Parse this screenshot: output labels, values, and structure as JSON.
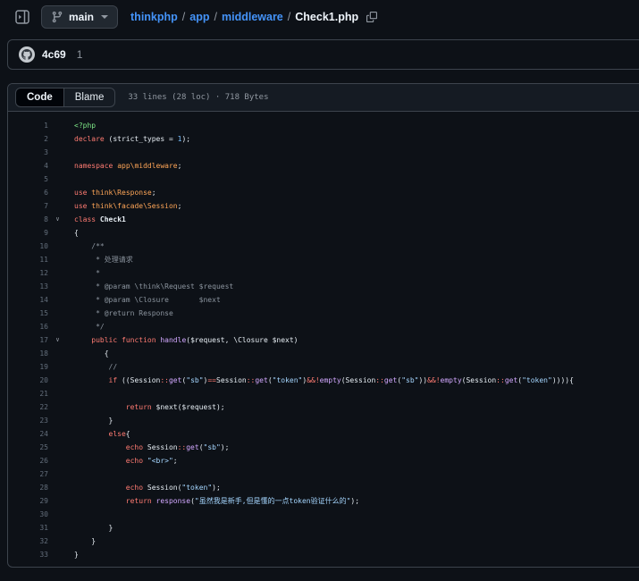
{
  "topbar": {
    "branch": "main",
    "breadcrumb": [
      "thinkphp",
      "app",
      "middleware"
    ],
    "separator": "/",
    "filename": "Check1.php",
    "icons": [
      "sidebar-expand-icon",
      "git-branch-icon",
      "caret-down-icon",
      "copy-path-icon"
    ]
  },
  "commit": {
    "title": "4c69",
    "meta": "1",
    "avatar_icon": "github-octocat-avatar"
  },
  "file_header": {
    "tabs": [
      {
        "label": "Code",
        "active": true
      },
      {
        "label": "Blame",
        "active": false
      }
    ],
    "meta": "33 lines (28 loc) · 718 Bytes"
  },
  "colors": {
    "page_bg": "#0d1117",
    "header_bg": "#151b23",
    "border": "#3d444d",
    "link_blue": "#4493f8",
    "text": "#f0f6fc",
    "muted": "#9198a1",
    "line_number": "#636e7b",
    "syntax_keyword": "#ff7b72",
    "syntax_entity": "#d2a8ff",
    "syntax_string": "#a5d6ff",
    "syntax_constant": "#79c0ff",
    "syntax_comment": "#8b949e",
    "syntax_namespace": "#ffa657",
    "syntax_tag": "#7ee787"
  },
  "code": {
    "lines": [
      {
        "n": 1,
        "segs": [
          [
            "g",
            "<?php"
          ]
        ]
      },
      {
        "n": 2,
        "segs": [
          [
            "k",
            "declare"
          ],
          [
            "p",
            " (strict_types = "
          ],
          [
            "c",
            "1"
          ],
          [
            "p",
            ");"
          ]
        ]
      },
      {
        "n": 3,
        "segs": []
      },
      {
        "n": 4,
        "segs": [
          [
            "k",
            "namespace"
          ],
          [
            "p",
            " "
          ],
          [
            "o",
            "app\\middleware"
          ],
          [
            "p",
            ";"
          ]
        ]
      },
      {
        "n": 5,
        "segs": []
      },
      {
        "n": 6,
        "segs": [
          [
            "k",
            "use"
          ],
          [
            "p",
            " "
          ],
          [
            "o",
            "think\\Response"
          ],
          [
            "p",
            ";"
          ]
        ]
      },
      {
        "n": 7,
        "segs": [
          [
            "k",
            "use"
          ],
          [
            "p",
            " "
          ],
          [
            "o",
            "think\\facade\\Session"
          ],
          [
            "p",
            ";"
          ]
        ]
      },
      {
        "n": 8,
        "fold": true,
        "segs": [
          [
            "k",
            "class"
          ],
          [
            "p",
            " "
          ],
          [
            "b",
            "Check1"
          ]
        ]
      },
      {
        "n": 9,
        "segs": [
          [
            "p",
            "{"
          ]
        ]
      },
      {
        "n": 10,
        "segs": [
          [
            "m",
            "    /**"
          ]
        ]
      },
      {
        "n": 11,
        "segs": [
          [
            "m",
            "     * 处理请求"
          ]
        ]
      },
      {
        "n": 12,
        "segs": [
          [
            "m",
            "     *"
          ]
        ]
      },
      {
        "n": 13,
        "segs": [
          [
            "m",
            "     * @param \\think\\Request $request"
          ]
        ]
      },
      {
        "n": 14,
        "segs": [
          [
            "m",
            "     * @param \\Closure       $next"
          ]
        ]
      },
      {
        "n": 15,
        "segs": [
          [
            "m",
            "     * @return Response"
          ]
        ]
      },
      {
        "n": 16,
        "segs": [
          [
            "m",
            "     */"
          ]
        ]
      },
      {
        "n": 17,
        "fold": true,
        "segs": [
          [
            "p",
            "    "
          ],
          [
            "k",
            "public"
          ],
          [
            "p",
            " "
          ],
          [
            "k",
            "function"
          ],
          [
            "p",
            " "
          ],
          [
            "e",
            "handle"
          ],
          [
            "p",
            "($request, \\Closure $next)"
          ]
        ]
      },
      {
        "n": 18,
        "segs": [
          [
            "p",
            "       {"
          ]
        ]
      },
      {
        "n": 19,
        "segs": [
          [
            "m",
            "        //"
          ]
        ]
      },
      {
        "n": 20,
        "segs": [
          [
            "p",
            "        "
          ],
          [
            "k",
            "if"
          ],
          [
            "p",
            " ((Session"
          ],
          [
            "k",
            "::"
          ],
          [
            "e",
            "get"
          ],
          [
            "p",
            "("
          ],
          [
            "s",
            "\"sb\""
          ],
          [
            "p",
            ")"
          ],
          [
            "k",
            "=="
          ],
          [
            "p",
            "Session"
          ],
          [
            "k",
            "::"
          ],
          [
            "e",
            "get"
          ],
          [
            "p",
            "("
          ],
          [
            "s",
            "\"token\""
          ],
          [
            "p",
            ")"
          ],
          [
            "k",
            "&&!"
          ],
          [
            "e",
            "empty"
          ],
          [
            "p",
            "(Session"
          ],
          [
            "k",
            "::"
          ],
          [
            "e",
            "get"
          ],
          [
            "p",
            "("
          ],
          [
            "s",
            "\"sb\""
          ],
          [
            "p",
            "))"
          ],
          [
            "k",
            "&&!"
          ],
          [
            "e",
            "empty"
          ],
          [
            "p",
            "(Session"
          ],
          [
            "k",
            "::"
          ],
          [
            "e",
            "get"
          ],
          [
            "p",
            "("
          ],
          [
            "s",
            "\"token\""
          ],
          [
            "p",
            ")))){"
          ]
        ]
      },
      {
        "n": 21,
        "segs": []
      },
      {
        "n": 22,
        "segs": [
          [
            "p",
            "            "
          ],
          [
            "k",
            "return"
          ],
          [
            "p",
            " $next($request);"
          ]
        ]
      },
      {
        "n": 23,
        "segs": [
          [
            "p",
            "        }"
          ]
        ]
      },
      {
        "n": 24,
        "segs": [
          [
            "p",
            "        "
          ],
          [
            "k",
            "else"
          ],
          [
            "p",
            "{"
          ]
        ]
      },
      {
        "n": 25,
        "segs": [
          [
            "p",
            "            "
          ],
          [
            "k",
            "echo"
          ],
          [
            "p",
            " Session"
          ],
          [
            "k",
            "::"
          ],
          [
            "e",
            "get"
          ],
          [
            "p",
            "("
          ],
          [
            "s",
            "\"sb\""
          ],
          [
            "p",
            ");"
          ]
        ]
      },
      {
        "n": 26,
        "segs": [
          [
            "p",
            "            "
          ],
          [
            "k",
            "echo"
          ],
          [
            "p",
            " "
          ],
          [
            "s",
            "\"<br>\""
          ],
          [
            "p",
            ";"
          ]
        ]
      },
      {
        "n": 27,
        "segs": []
      },
      {
        "n": 28,
        "segs": [
          [
            "p",
            "            "
          ],
          [
            "k",
            "echo"
          ],
          [
            "p",
            " Session("
          ],
          [
            "s",
            "\"token\""
          ],
          [
            "p",
            ");"
          ]
        ]
      },
      {
        "n": 29,
        "segs": [
          [
            "p",
            "            "
          ],
          [
            "k",
            "return"
          ],
          [
            "p",
            " "
          ],
          [
            "e",
            "response"
          ],
          [
            "p",
            "("
          ],
          [
            "s",
            "\"虽然我是新手,但是懂的一点token验证什么的\""
          ],
          [
            "p",
            ");"
          ]
        ]
      },
      {
        "n": 30,
        "segs": []
      },
      {
        "n": 31,
        "segs": [
          [
            "p",
            "        }"
          ]
        ]
      },
      {
        "n": 32,
        "segs": [
          [
            "p",
            "    }"
          ]
        ]
      },
      {
        "n": 33,
        "segs": [
          [
            "p",
            "}"
          ]
        ]
      }
    ]
  }
}
